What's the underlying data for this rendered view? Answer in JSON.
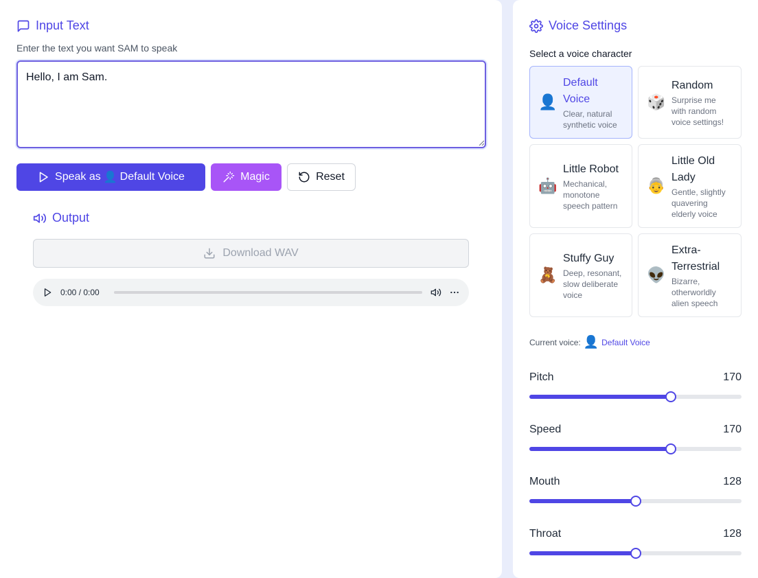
{
  "input": {
    "title": "Input Text",
    "hint": "Enter the text you want SAM to speak",
    "text": "Hello, I am Sam."
  },
  "buttons": {
    "speak_prefix": "Speak as",
    "speak_emoji": "👤",
    "speak_voice": "Default Voice",
    "magic": "Magic",
    "reset": "Reset"
  },
  "output": {
    "title": "Output",
    "download": "Download WAV",
    "time": "0:00 / 0:00"
  },
  "voice_settings": {
    "title": "Voice Settings",
    "select_label": "Select a voice character",
    "voices": [
      {
        "emoji": "👤",
        "name": "Default Voice",
        "desc": "Clear, natural synthetic voice",
        "selected": true
      },
      {
        "emoji": "🎲",
        "name": "Random",
        "desc": "Surprise me with random voice settings!",
        "selected": false
      },
      {
        "emoji": "🤖",
        "name": "Little Robot",
        "desc": "Mechanical, monotone speech pattern",
        "selected": false
      },
      {
        "emoji": "👵",
        "name": "Little Old Lady",
        "desc": "Gentle, slightly quavering elderly voice",
        "selected": false
      },
      {
        "emoji": "🧸",
        "name": "Stuffy Guy",
        "desc": "Deep, resonant, slow deliberate voice",
        "selected": false
      },
      {
        "emoji": "👽",
        "name": "Extra-Terrestrial",
        "desc": "Bizarre, otherworldly alien speech",
        "selected": false
      }
    ],
    "current_label": "Current voice:",
    "current_emoji": "👤",
    "current_name": "Default Voice"
  },
  "sliders": [
    {
      "label": "Pitch",
      "value": 170,
      "max": 255
    },
    {
      "label": "Speed",
      "value": 170,
      "max": 255
    },
    {
      "label": "Mouth",
      "value": 128,
      "max": 255
    },
    {
      "label": "Throat",
      "value": 128,
      "max": 255
    }
  ],
  "colors": {
    "accent": "#4f46e5",
    "magic": "#a855f7"
  }
}
